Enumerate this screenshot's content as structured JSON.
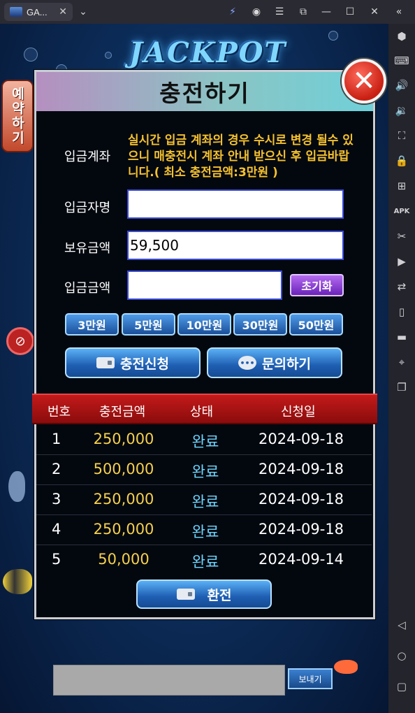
{
  "window": {
    "tab_title": "GA...",
    "tab_close": "✕",
    "dropdown": "⌄",
    "controls": [
      "⚡",
      "◉",
      "☰",
      "⧉",
      "—",
      "☐",
      "✕",
      "«"
    ]
  },
  "game": {
    "jackpot_logo": "JACKPOT",
    "reserve_button": "예약하기",
    "chat_placeholder": "",
    "send_button": "보내기"
  },
  "modal": {
    "title": "충전하기",
    "close": "✕",
    "deposit_account_label": "입금계좌",
    "notice": "실시간 입금 계좌의 경우 수시로 변경 될수 있으니 매충전시 계좌 안내 받으신 후 입금바랍니다.( 최소 충전금액:3만원 )",
    "depositor_label": "입금자명",
    "depositor_value": "",
    "balance_label": "보유금액",
    "balance_value": "59,500",
    "amount_label": "입금금액",
    "amount_value": "",
    "reset_button": "초기화",
    "quick_amounts": [
      "3만원",
      "5만원",
      "10만원",
      "30만원",
      "50만원"
    ],
    "apply_button": "충전신청",
    "inquiry_button": "문의하기",
    "table": {
      "headers": [
        "번호",
        "충전금액",
        "상태",
        "신청일"
      ],
      "rows": [
        {
          "num": "1",
          "amount": "250,000",
          "status": "완료",
          "date": "2024-09-18"
        },
        {
          "num": "2",
          "amount": "500,000",
          "status": "완료",
          "date": "2024-09-18"
        },
        {
          "num": "3",
          "amount": "250,000",
          "status": "완료",
          "date": "2024-09-18"
        },
        {
          "num": "4",
          "amount": "250,000",
          "status": "완료",
          "date": "2024-09-18"
        },
        {
          "num": "5",
          "amount": "50,000",
          "status": "완료",
          "date": "2024-09-14"
        }
      ]
    },
    "withdraw_button": "환전"
  },
  "sidebar_icons": [
    "hexagon-icon",
    "keyboard-icon",
    "volume-up-icon",
    "volume-down-icon",
    "fullscreen-icon",
    "lock-icon",
    "add-icon",
    "apk-icon",
    "scissors-icon",
    "record-icon",
    "sync-icon",
    "rotate-icon",
    "folder-icon",
    "location-icon",
    "multi-instance-icon",
    "back-icon",
    "home-icon",
    "recents-icon"
  ]
}
